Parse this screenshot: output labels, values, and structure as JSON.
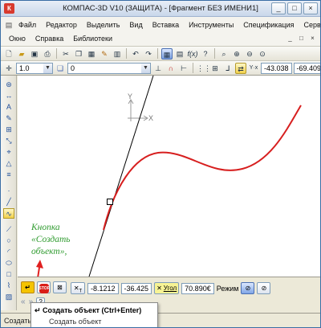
{
  "window": {
    "title": "КОМПАС-3D V10 (ЗАЩИТА) - [Фрагмент БЕЗ ИМЕНИ1]",
    "logo_text": "К",
    "controls": [
      "_",
      "□",
      "×"
    ]
  },
  "menu": {
    "row1": [
      "Файл",
      "Редактор",
      "Выделить",
      "Вид",
      "Вставка",
      "Инструменты",
      "Спецификация",
      "Сервис"
    ],
    "row2": [
      "Окно",
      "Справка",
      "Библиотеки"
    ],
    "mdi_controls": [
      "_",
      "□",
      "×"
    ]
  },
  "toolbar2": {
    "line_scale": "1.0",
    "layer": "0",
    "coord_x": "-43.038",
    "coord_y": "-69.409"
  },
  "canvas": {
    "axis_x_label": "X",
    "axis_y_label": "Y",
    "line_color": "#000000",
    "curve_color": "#d71f1f"
  },
  "annotation": {
    "line1": "Кнопка",
    "line2": "«Создать",
    "line3": "объект»,",
    "color": "#2f9b2f",
    "arrow_color": "#e02020"
  },
  "panel": {
    "t_label": "T",
    "t_x": "-8.1212",
    "t_y": "-36.425",
    "angle_label": "Угол",
    "angle_value": "70.890€",
    "mode_label": "Режим",
    "stop_text": "STOP",
    "nav_left": "«",
    "nav_right": "»"
  },
  "tooltip": {
    "title": "Создать объект (Ctrl+Enter)",
    "subtitle": "Создать объект"
  },
  "status": {
    "text": "Создать"
  }
}
